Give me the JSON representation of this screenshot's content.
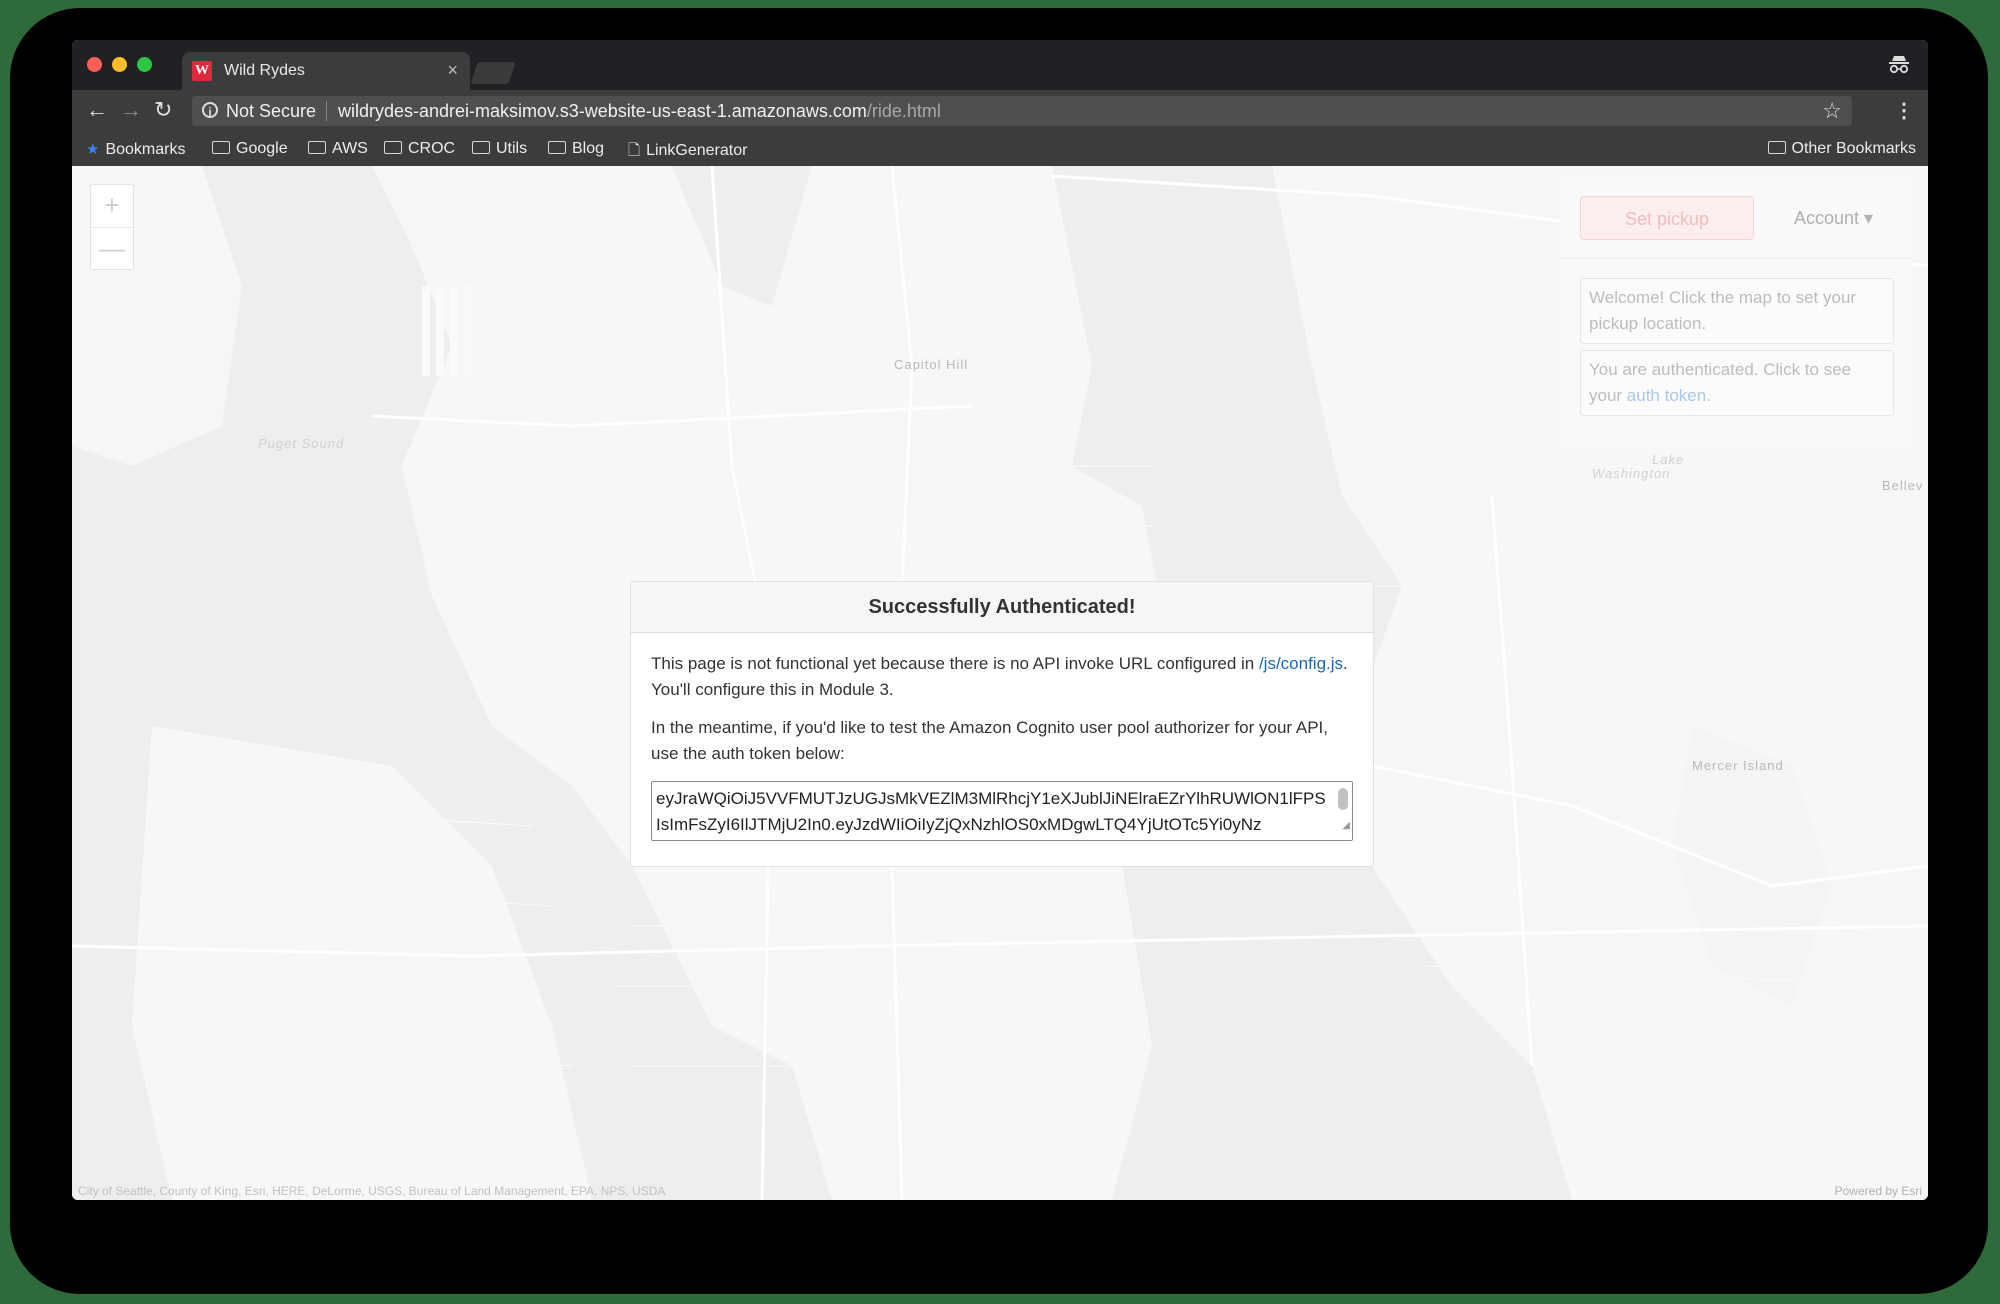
{
  "tab": {
    "title": "Wild Rydes",
    "favicon_letter": "W"
  },
  "addressbar": {
    "security_label": "Not Secure",
    "url_host": "wildrydes-andrei-maksimov.s3-website-us-east-1.amazonaws.com",
    "url_path": "/ride.html"
  },
  "bookmarks": {
    "items": [
      {
        "label": "Bookmarks",
        "icon": "star-icon"
      },
      {
        "label": "Google",
        "icon": "folder-icon"
      },
      {
        "label": "AWS",
        "icon": "folder-icon"
      },
      {
        "label": "CROC",
        "icon": "folder-icon"
      },
      {
        "label": "Utils",
        "icon": "folder-icon"
      },
      {
        "label": "Blog",
        "icon": "folder-icon"
      },
      {
        "label": "LinkGenerator",
        "icon": "page-icon"
      }
    ],
    "other": "Other Bookmarks"
  },
  "map": {
    "labels": {
      "capitol_hill": "Capitol Hill",
      "puget_sound": "Puget Sound",
      "lake": "Lake",
      "washington": "Washington",
      "bellevue": "Bellev",
      "mercer_island": "Mercer Island"
    },
    "zoom_in": "+",
    "zoom_out": "—",
    "attribution": "City of Seattle, County of King, Esri, HERE, DeLorme, USGS, Bureau of Land Management, EPA, NPS, USDA",
    "powered_by": "Powered by Esri"
  },
  "panel": {
    "set_pickup": "Set pickup",
    "account": "Account ▾",
    "welcome": "Welcome! Click the map to set your pickup location.",
    "auth_prefix": "You are authenticated. Click to see your ",
    "auth_link": "auth token",
    "auth_suffix": "."
  },
  "modal": {
    "title": "Successfully Authenticated!",
    "p1_before": "This page is not functional yet because there is no API invoke URL configured in ",
    "p1_link": "/js/config.js",
    "p1_after": ". You'll configure this in Module 3.",
    "p2": "In the meantime, if you'd like to test the Amazon Cognito user pool authorizer for your API, use the auth token below:",
    "token": "eyJraWQiOiJ5VVFMUTJzUGJsMkVEZlM3MlRhcjY1eXJublJiNElraEZrYlhRUWlON1lFPSIsImFsZyI6IlJTMjU2In0.eyJzdWIiOiIyZjQxNzhlOS0xMDgwLTQ4YjUtOTc5Yi0yNz"
  },
  "colors": {
    "accent_red": "#e0293d",
    "link_blue": "#1e68b3",
    "chrome_dark": "#3c3c3c"
  }
}
